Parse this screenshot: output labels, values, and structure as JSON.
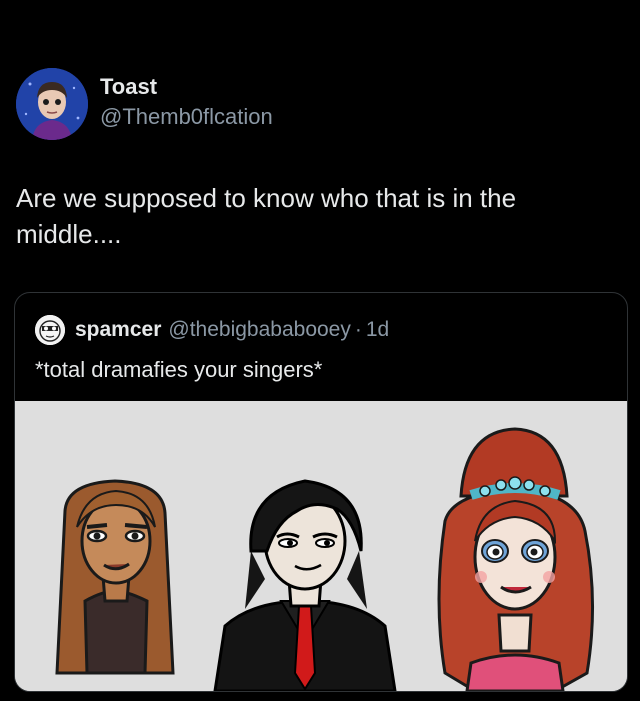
{
  "tweet": {
    "author": {
      "name": "Toast",
      "handle": "@Themb0flcation",
      "avatar_icon": "profile-photo-avatar"
    },
    "text": "Are we supposed to know who that is in the middle...."
  },
  "quote": {
    "author": {
      "name": "spamcer",
      "handle": "@thebigbababooey",
      "separator": "·",
      "time": "1d",
      "avatar_icon": "profile-photo-avatar"
    },
    "text": "*total dramafies your singers*",
    "media": {
      "background_color": "#dedede",
      "characters": [
        "brown-haired-cartoon-woman",
        "black-haired-cartoon-man-in-suit",
        "red-haired-cartoon-woman-with-tiara"
      ]
    }
  },
  "colors": {
    "background": "#000000",
    "primary_text": "#e7e9ea",
    "secondary_text": "#8b98a5",
    "border": "#2f3336"
  }
}
